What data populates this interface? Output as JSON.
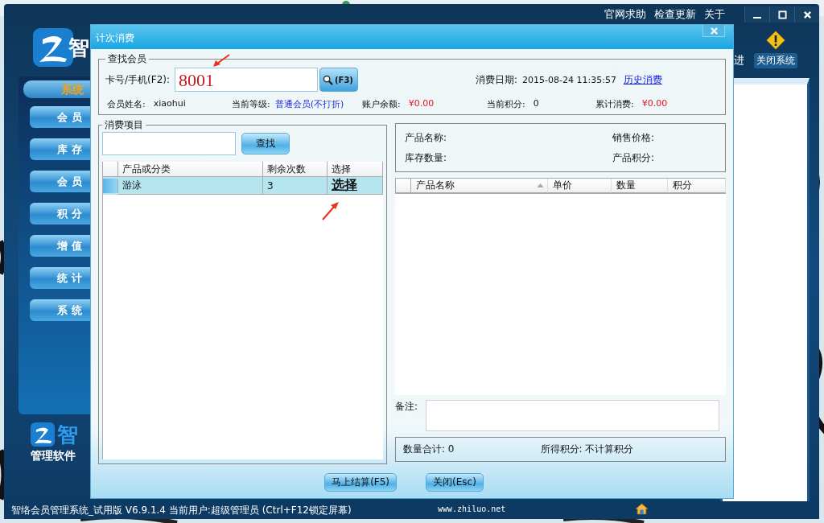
{
  "app": {
    "logo_text": "智",
    "top_links": [
      "官网求助",
      "检查更新",
      "关于"
    ],
    "header_partial": "进",
    "close_system": "关闭系统",
    "sidebar_header": "系统",
    "nav": [
      "会 员",
      "库 存",
      "会 员",
      "积 分",
      "增 值",
      "统 计",
      "系 统"
    ],
    "bottom_logo": "智",
    "slogan": "管理软件",
    "status_text": "智络会员管理系统_试用版 V6.9.1.4 当前用户:超级管理员 (Ctrl+F12锁定屏幕)",
    "website": "www.zhiluo.net"
  },
  "dialog": {
    "title": "计次消费",
    "member_group": {
      "legend": "查找会员",
      "card_label": "卡号/手机(F2):",
      "card_value": "8001",
      "search_button": "(F3)",
      "date_label": "消费日期:",
      "date_value": "2015-08-24 11:35:57",
      "history_link": "历史消费",
      "fields": [
        {
          "label": "会员姓名:",
          "value": "xiaohui",
          "kind": "plain"
        },
        {
          "label": "当前等级:",
          "value": "普通会员(不打折)",
          "kind": "level"
        },
        {
          "label": "账户余额:",
          "value": "¥0.00",
          "kind": "money"
        },
        {
          "label": "当前积分:",
          "value": "0",
          "kind": "plain"
        },
        {
          "label": "累计消费:",
          "value": "¥0.00",
          "kind": "money"
        }
      ]
    },
    "items_group": {
      "legend": "消费项目",
      "find_button": "查找",
      "columns": [
        "产品或分类",
        "剩余次数",
        "选择"
      ],
      "rows": [
        {
          "name": "游泳",
          "remaining": "3",
          "action": "选择",
          "selected": true
        }
      ]
    },
    "product_info": [
      {
        "label": "产品名称:"
      },
      {
        "label": "销售价格:"
      },
      {
        "label": "库存数量:"
      },
      {
        "label": "产品积分:"
      }
    ],
    "cart_columns": [
      "产品名称",
      "单价",
      "数量",
      "积分"
    ],
    "note_label": "备注:",
    "total_qty": "数量合计: 0",
    "points": "所得积分: 不计算积分",
    "buttons": [
      "马上结算(F5)",
      "关闭(Esc)"
    ]
  }
}
